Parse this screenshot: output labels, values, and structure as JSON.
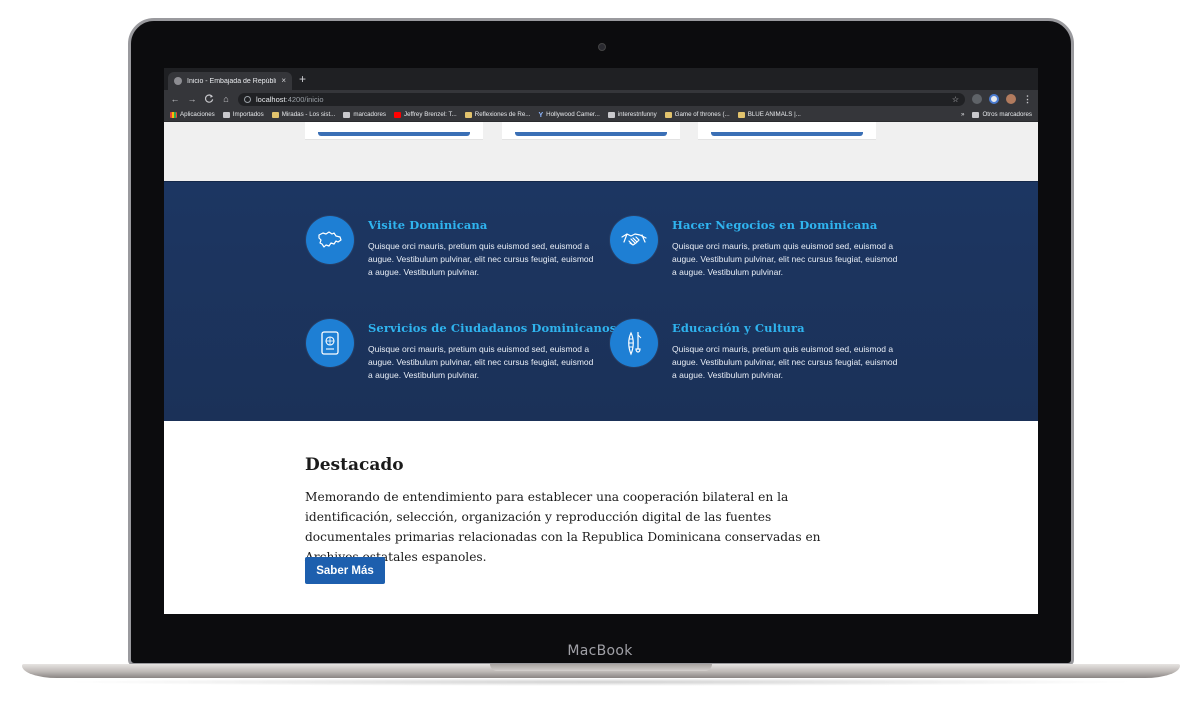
{
  "device": {
    "label": "MacBook"
  },
  "browser": {
    "tab_title": "Inicio - Embajada de República",
    "tab_close": "×",
    "new_tab": "+",
    "url_host": "localhost",
    "url_path": ":4200/inicio",
    "nav": {
      "back": "←",
      "forward": "→",
      "reload": "C",
      "home": "⌂",
      "star": "☆",
      "menu": "⋮"
    },
    "bookmarks": [
      {
        "label": "Aplicaciones",
        "icon": "apps-grid-icon"
      },
      {
        "label": "Importados",
        "icon": "folder-icon"
      },
      {
        "label": "Miradas - Los sist...",
        "icon": "site-icon"
      },
      {
        "label": "marcadores",
        "icon": "folder-icon"
      },
      {
        "label": "Jeffrey Brenzel: T...",
        "icon": "youtube-icon"
      },
      {
        "label": "Reflexiones de Re...",
        "icon": "site-icon"
      },
      {
        "label": "Hollywood Camer...",
        "icon": "yahoo-icon"
      },
      {
        "label": "interestnfunny",
        "icon": "folder-icon"
      },
      {
        "label": "Game of thrones (...",
        "icon": "site-icon"
      },
      {
        "label": "BLUE ANIMALS |...",
        "icon": "site-icon"
      }
    ],
    "bookmarks_overflow": "»",
    "other_bookmarks": "Otros marcadores"
  },
  "features": [
    {
      "title": "Visite Dominicana",
      "text": "Quisque orci mauris, pretium quis euismod sed, euismod a augue. Vestibulum pulvinar, elit nec cursus feugiat, euismod a augue. Vestibulum pulvinar.",
      "icon": "dominican-map-icon"
    },
    {
      "title": "Hacer Negocios en Dominicana",
      "text": "Quisque orci mauris, pretium quis euismod sed, euismod a augue. Vestibulum pulvinar, elit nec cursus feugiat, euismod a augue. Vestibulum pulvinar.",
      "icon": "handshake-icon"
    },
    {
      "title": "Servicios de Ciudadanos Dominicanos",
      "text": "Quisque orci mauris, pretium quis euismod sed, euismod a augue. Vestibulum pulvinar, elit nec cursus feugiat, euismod a augue. Vestibulum pulvinar.",
      "icon": "passport-icon"
    },
    {
      "title": "Educación y Cultura",
      "text": "Quisque orci mauris, pretium quis euismod sed, euismod a augue. Vestibulum pulvinar, elit nec cursus feugiat, euismod a augue. Vestibulum pulvinar.",
      "icon": "culture-instruments-icon"
    }
  ],
  "featured": {
    "heading": "Destacado",
    "text": "Memorando de entendimiento para establecer una cooperación bilateral en la identificación, selección, organización y reproducción digital de las fuentes documentales primarias relacionadas con la Republica Dominicana conservadas en Archivos estatales espanoles.",
    "button_label": "Saber Más"
  },
  "colors": {
    "section_blue": "#1c3662",
    "icon_circle": "#1e7fd4",
    "feature_title": "#2fb4ef",
    "button": "#1d5fae"
  }
}
